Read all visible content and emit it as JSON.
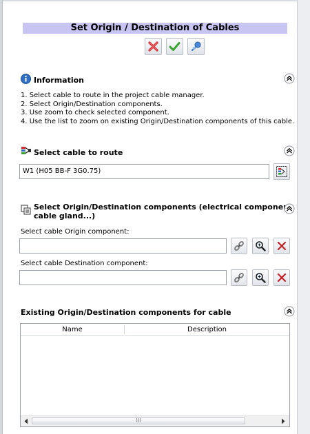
{
  "dialog": {
    "title": "Set Origin / Destination of Cables",
    "toolbar": {
      "cancel_icon": "cancel-x-icon",
      "ok_icon": "ok-check-icon",
      "pin_icon": "pushpin-icon"
    }
  },
  "info_section": {
    "title": "Information",
    "icon": "info-icon",
    "lines": [
      "1. Select cable to route in the project cable manager.",
      "2. Select Origin/Destination components.",
      "3. Use zoom to check selected component.",
      "4. Use the list to zoom on existing Origin/Destination components of this cable."
    ]
  },
  "cable_section": {
    "title": "Select cable to route",
    "icon": "cable-icon",
    "value": "W1 (H05 BB-F 3G0.75)"
  },
  "components_section": {
    "title_line1": "Select Origin/Destination components (electrical component,",
    "title_line2": "cable gland...)",
    "origin_label": "Select cable Origin component:",
    "origin_value": "",
    "destination_label": "Select cable Destination component:",
    "destination_value": ""
  },
  "existing_section": {
    "title": "Existing Origin/Destination components for cable",
    "columns": [
      "Name",
      "Description"
    ],
    "rows": [],
    "scroll_grip": "III"
  },
  "colors": {
    "title_bar": "#c9c5f3",
    "cancel_red": "#d8262b",
    "ok_green": "#39a531",
    "accent_blue": "#2f6fc4"
  }
}
